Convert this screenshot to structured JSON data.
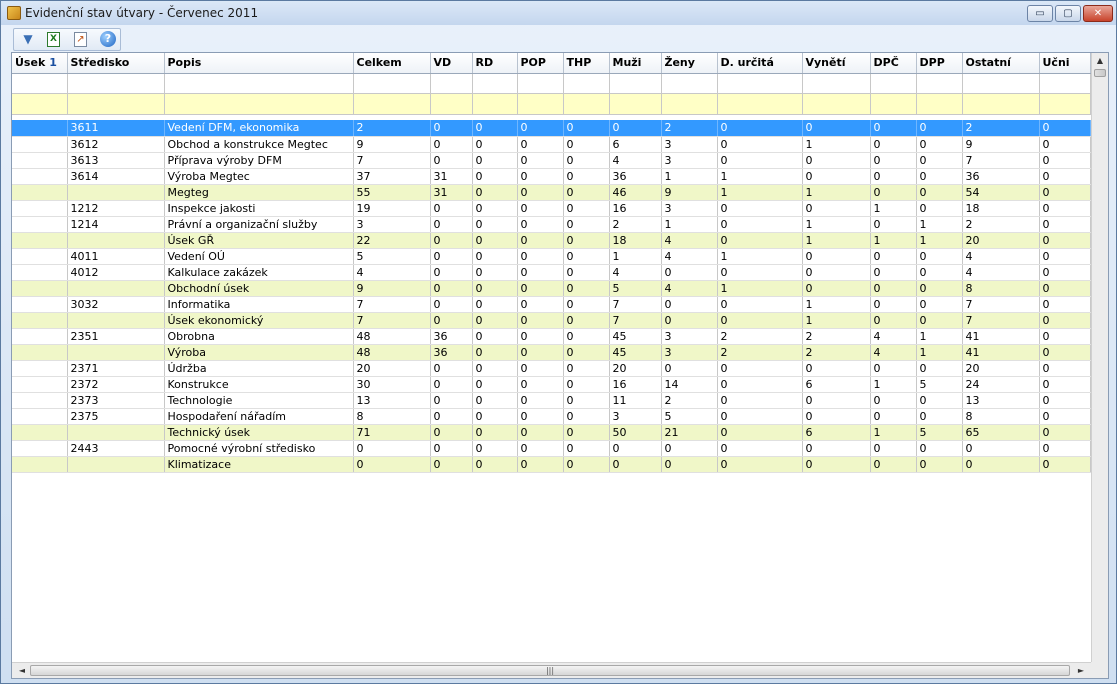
{
  "window": {
    "title": "Evidenční stav útvary - Červenec 2011",
    "icon": "app-icon",
    "controls": {
      "minimize": "▭",
      "maximize": "▢",
      "close": "✕"
    }
  },
  "toolbar": {
    "filter_icon": "▼",
    "excel_icon": "X",
    "edit_icon": "↗",
    "help_icon": "?"
  },
  "grid": {
    "sort_indicator": "1",
    "columns": [
      "Úsek",
      "Středisko",
      "Popis",
      "Celkem",
      "VD",
      "RD",
      "POP",
      "THP",
      "Muži",
      "Ženy",
      "D. určitá",
      "Vynětí",
      "DPČ",
      "DPP",
      "Ostatní",
      "Učni"
    ],
    "rows": [
      {
        "type": "selected",
        "cells": [
          "",
          "3611",
          "Vedení DFM, ekonomika",
          "2",
          "0",
          "0",
          "0",
          "0",
          "0",
          "2",
          "0",
          "0",
          "0",
          "0",
          "2",
          "0"
        ]
      },
      {
        "type": "data",
        "cells": [
          "",
          "3612",
          "Obchod a konstrukce Megtec",
          "9",
          "0",
          "0",
          "0",
          "0",
          "6",
          "3",
          "0",
          "1",
          "0",
          "0",
          "9",
          "0"
        ]
      },
      {
        "type": "data",
        "cells": [
          "",
          "3613",
          "Příprava výroby DFM",
          "7",
          "0",
          "0",
          "0",
          "0",
          "4",
          "3",
          "0",
          "0",
          "0",
          "0",
          "7",
          "0"
        ]
      },
      {
        "type": "data",
        "cells": [
          "",
          "3614",
          "Výroba Megtec",
          "37",
          "31",
          "0",
          "0",
          "0",
          "36",
          "1",
          "1",
          "0",
          "0",
          "0",
          "36",
          "0"
        ]
      },
      {
        "type": "subtotal",
        "cells": [
          "",
          "",
          "Megteg",
          "55",
          "31",
          "0",
          "0",
          "0",
          "46",
          "9",
          "1",
          "1",
          "0",
          "0",
          "54",
          "0"
        ]
      },
      {
        "type": "data",
        "cells": [
          "",
          "1212",
          "Inspekce jakosti",
          "19",
          "0",
          "0",
          "0",
          "0",
          "16",
          "3",
          "0",
          "0",
          "1",
          "0",
          "18",
          "0"
        ]
      },
      {
        "type": "data",
        "cells": [
          "",
          "1214",
          "Právní a organizační služby",
          "3",
          "0",
          "0",
          "0",
          "0",
          "2",
          "1",
          "0",
          "1",
          "0",
          "1",
          "2",
          "0"
        ]
      },
      {
        "type": "subtotal",
        "cells": [
          "",
          "",
          "Úsek GŘ",
          "22",
          "0",
          "0",
          "0",
          "0",
          "18",
          "4",
          "0",
          "1",
          "1",
          "1",
          "20",
          "0"
        ]
      },
      {
        "type": "data",
        "cells": [
          "",
          "4011",
          "Vedení OÚ",
          "5",
          "0",
          "0",
          "0",
          "0",
          "1",
          "4",
          "1",
          "0",
          "0",
          "0",
          "4",
          "0"
        ]
      },
      {
        "type": "data",
        "cells": [
          "",
          "4012",
          "Kalkulace zakázek",
          "4",
          "0",
          "0",
          "0",
          "0",
          "4",
          "0",
          "0",
          "0",
          "0",
          "0",
          "4",
          "0"
        ]
      },
      {
        "type": "subtotal",
        "cells": [
          "",
          "",
          "Obchodní úsek",
          "9",
          "0",
          "0",
          "0",
          "0",
          "5",
          "4",
          "1",
          "0",
          "0",
          "0",
          "8",
          "0"
        ]
      },
      {
        "type": "data",
        "cells": [
          "",
          "3032",
          "Informatika",
          "7",
          "0",
          "0",
          "0",
          "0",
          "7",
          "0",
          "0",
          "1",
          "0",
          "0",
          "7",
          "0"
        ]
      },
      {
        "type": "subtotal",
        "cells": [
          "",
          "",
          "Úsek ekonomický",
          "7",
          "0",
          "0",
          "0",
          "0",
          "7",
          "0",
          "0",
          "1",
          "0",
          "0",
          "7",
          "0"
        ]
      },
      {
        "type": "data",
        "cells": [
          "",
          "2351",
          "Obrobna",
          "48",
          "36",
          "0",
          "0",
          "0",
          "45",
          "3",
          "2",
          "2",
          "4",
          "1",
          "41",
          "0"
        ]
      },
      {
        "type": "subtotal",
        "cells": [
          "",
          "",
          "Výroba",
          "48",
          "36",
          "0",
          "0",
          "0",
          "45",
          "3",
          "2",
          "2",
          "4",
          "1",
          "41",
          "0"
        ]
      },
      {
        "type": "data",
        "cells": [
          "",
          "2371",
          "Údržba",
          "20",
          "0",
          "0",
          "0",
          "0",
          "20",
          "0",
          "0",
          "0",
          "0",
          "0",
          "20",
          "0"
        ]
      },
      {
        "type": "data",
        "cells": [
          "",
          "2372",
          "Konstrukce",
          "30",
          "0",
          "0",
          "0",
          "0",
          "16",
          "14",
          "0",
          "6",
          "1",
          "5",
          "24",
          "0"
        ]
      },
      {
        "type": "data",
        "cells": [
          "",
          "2373",
          "Technologie",
          "13",
          "0",
          "0",
          "0",
          "0",
          "11",
          "2",
          "0",
          "0",
          "0",
          "0",
          "13",
          "0"
        ]
      },
      {
        "type": "data",
        "cells": [
          "",
          "2375",
          "Hospodaření nářadím",
          "8",
          "0",
          "0",
          "0",
          "0",
          "3",
          "5",
          "0",
          "0",
          "0",
          "0",
          "8",
          "0"
        ]
      },
      {
        "type": "subtotal",
        "cells": [
          "",
          "",
          "Technický úsek",
          "71",
          "0",
          "0",
          "0",
          "0",
          "50",
          "21",
          "0",
          "6",
          "1",
          "5",
          "65",
          "0"
        ]
      },
      {
        "type": "data",
        "cells": [
          "",
          "2443",
          "Pomocné výrobní středisko",
          "0",
          "0",
          "0",
          "0",
          "0",
          "0",
          "0",
          "0",
          "0",
          "0",
          "0",
          "0",
          "0"
        ]
      },
      {
        "type": "subtotal",
        "cells": [
          "",
          "",
          "Klimatizace",
          "0",
          "0",
          "0",
          "0",
          "0",
          "0",
          "0",
          "0",
          "0",
          "0",
          "0",
          "0",
          "0"
        ]
      }
    ]
  },
  "scrollbar": {
    "up": "▲",
    "left": "◄",
    "right": "►",
    "grip": "|||"
  }
}
